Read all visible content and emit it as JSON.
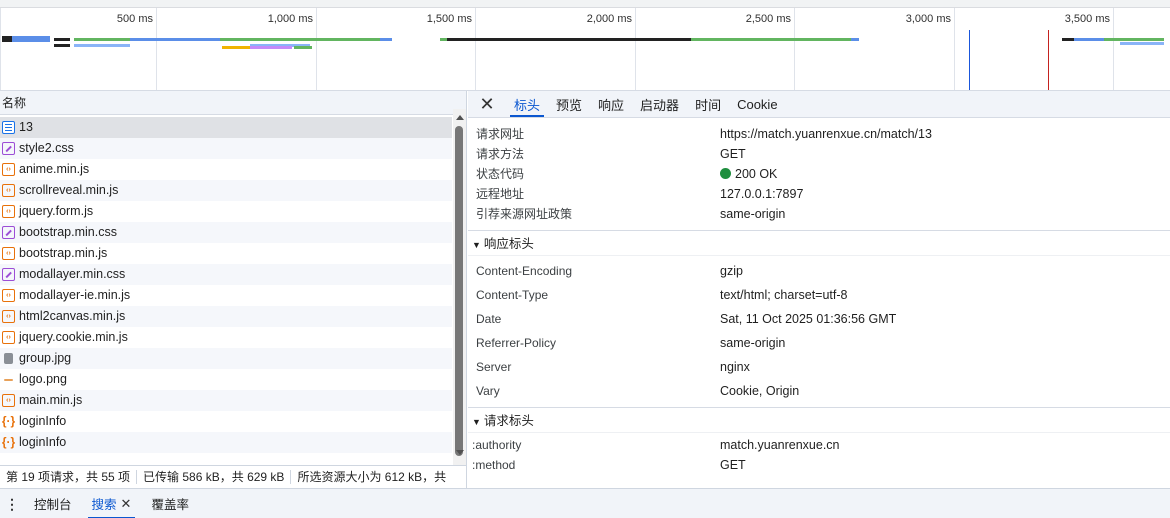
{
  "overview": {
    "ticks": [
      "500 ms",
      "1,000 ms",
      "1,500 ms",
      "2,000 ms",
      "2,500 ms",
      "3,000 ms",
      "3,500 ms"
    ]
  },
  "list": {
    "header": "名称",
    "rows": [
      {
        "name": "13",
        "type": "doc",
        "selected": true
      },
      {
        "name": "style2.css",
        "type": "css"
      },
      {
        "name": "anime.min.js",
        "type": "script"
      },
      {
        "name": "scrollreveal.min.js",
        "type": "script"
      },
      {
        "name": "jquery.form.js",
        "type": "script"
      },
      {
        "name": "bootstrap.min.css",
        "type": "css"
      },
      {
        "name": "bootstrap.min.js",
        "type": "script"
      },
      {
        "name": "modallayer.min.css",
        "type": "css"
      },
      {
        "name": "modallayer-ie.min.js",
        "type": "script"
      },
      {
        "name": "html2canvas.min.js",
        "type": "script"
      },
      {
        "name": "jquery.cookie.min.js",
        "type": "script"
      },
      {
        "name": "group.jpg",
        "type": "img"
      },
      {
        "name": "logo.png",
        "type": "png"
      },
      {
        "name": "main.min.js",
        "type": "script"
      },
      {
        "name": "loginInfo",
        "type": "xhr"
      },
      {
        "name": "loginInfo",
        "type": "xhr"
      }
    ]
  },
  "summary": {
    "requests": "第 19 项请求，共 55 项",
    "transferred": "已传输 586 kB，共 629 kB",
    "resources": "所选资源大小为 612 kB，共"
  },
  "tabs": [
    "标头",
    "预览",
    "响应",
    "启动器",
    "时间",
    "Cookie"
  ],
  "general": [
    {
      "k": "请求网址",
      "v": "https://match.yuanrenxue.cn/match/13"
    },
    {
      "k": "请求方法",
      "v": "GET"
    },
    {
      "k": "状态代码",
      "v": "200 OK"
    },
    {
      "k": "远程地址",
      "v": "127.0.0.1:7897"
    },
    {
      "k": "引荐来源网址政策",
      "v": "same-origin"
    }
  ],
  "response_headers": {
    "title": "响应标头",
    "items": [
      {
        "k": "Content-Encoding",
        "v": "gzip"
      },
      {
        "k": "Content-Type",
        "v": "text/html; charset=utf-8"
      },
      {
        "k": "Date",
        "v": "Sat, 11 Oct 2025 01:36:56 GMT"
      },
      {
        "k": "Referrer-Policy",
        "v": "same-origin"
      },
      {
        "k": "Server",
        "v": "nginx"
      },
      {
        "k": "Vary",
        "v": "Cookie, Origin"
      }
    ]
  },
  "request_headers": {
    "title": "请求标头",
    "items": [
      {
        "k": ":authority",
        "v": "match.yuanrenxue.cn"
      },
      {
        "k": ":method",
        "v": "GET"
      }
    ]
  },
  "drawer": {
    "tabs": [
      "控制台",
      "搜索",
      "覆盖率"
    ],
    "active": "搜索"
  },
  "colors": {
    "accent": "#0b57d0",
    "status_ok": "#1e8e3e",
    "script_icon": "#e8710a",
    "css_icon": "#9c4dd6",
    "doc_icon": "#1a73e8"
  }
}
